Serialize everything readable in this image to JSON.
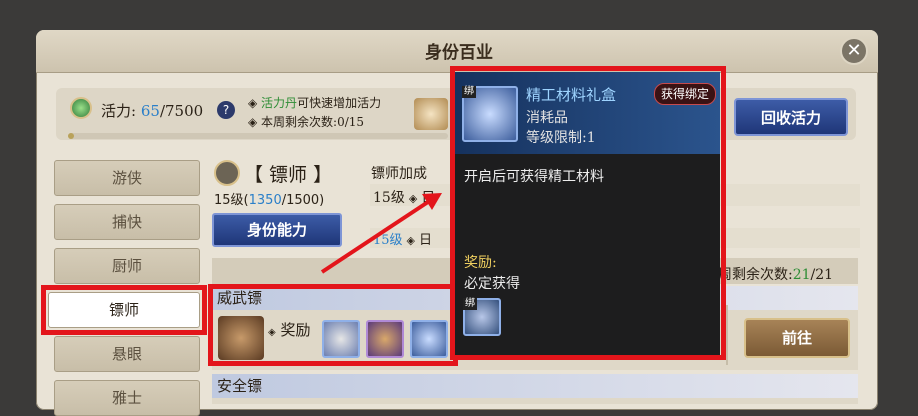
{
  "window": {
    "title": "身份百业",
    "close_glyph": "✕"
  },
  "vitality": {
    "label": "活力:",
    "current": "65",
    "max": "/7500",
    "help": "?",
    "progress": 0.0087
  },
  "info": {
    "line1_prefix": "◈ ",
    "line1_item": "活力丹",
    "line1_rest": "可快速增加活力",
    "line2": "◈ 本周剩余次数:0/15"
  },
  "recycle_button": "回收活力",
  "sidebar": {
    "items": [
      {
        "label": "游侠"
      },
      {
        "label": "捕快"
      },
      {
        "label": "厨师"
      },
      {
        "label": "镖师"
      },
      {
        "label": "悬眼"
      },
      {
        "label": "雅士"
      }
    ]
  },
  "role": {
    "title": "【 镖师 】",
    "level_prefix": "15级(",
    "xp": "1350",
    "xp_rest": "/1500)",
    "ability_button": "身份能力"
  },
  "bonus": {
    "title": "镖师加成",
    "row1_level": "15级",
    "row1_diamond": "◈",
    "row1_text": "日",
    "row2_level": "15级",
    "row2_diamond": "◈",
    "row2_text": "日"
  },
  "weekly": {
    "prefix": "周剩余次数:",
    "value": "21",
    "suffix": "/21"
  },
  "missions": [
    {
      "name": "威武镖",
      "reward_label": "奖励",
      "go_button": "前往"
    },
    {
      "name": "安全镖"
    }
  ],
  "tooltip": {
    "bind_tag": "绑",
    "item_name": "精工材料礼盒",
    "item_type": "消耗品",
    "level_limit": "等级限制:1",
    "bound_badge": "获得绑定",
    "description": "开启后可获得精工材料",
    "reward_title": "奖励:",
    "reward_text": "必定获得",
    "reward_tag": "绑"
  },
  "colors": {
    "accent_blue": "#2a7fc9",
    "highlight_red": "#e3151b",
    "button_blue": "#1f3678",
    "button_brown": "#7b5a35"
  }
}
